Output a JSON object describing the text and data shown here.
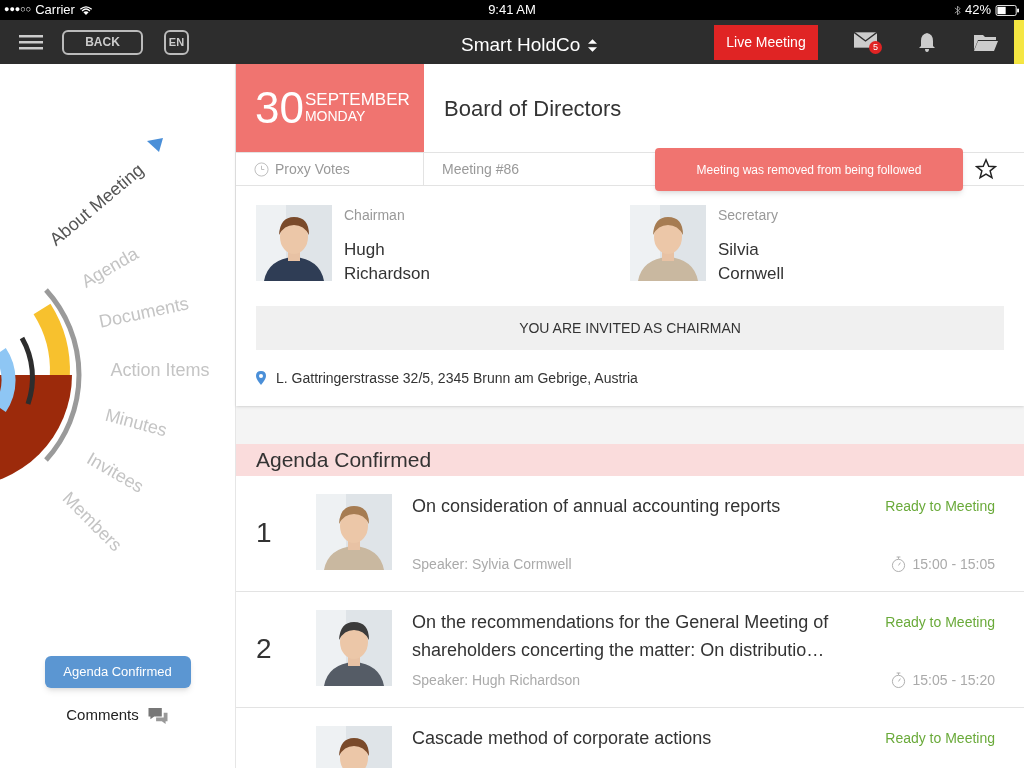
{
  "status_bar": {
    "signal": "●●●○○",
    "carrier": "Carrier",
    "time": "9:41 AM",
    "battery": "42%"
  },
  "nav": {
    "back": "BACK",
    "language": "EN",
    "title": "Smart HoldCo",
    "live": "Live Meeting",
    "mail_count": "5"
  },
  "sidebar": {
    "items": [
      {
        "label": "About Meeting",
        "selected": true
      },
      {
        "label": "Agenda",
        "selected": false
      },
      {
        "label": "Documents",
        "selected": false
      },
      {
        "label": "Action Items",
        "selected": false
      },
      {
        "label": "Minutes",
        "selected": false
      },
      {
        "label": "Invitees",
        "selected": false
      },
      {
        "label": "Members",
        "selected": false
      }
    ],
    "status_button": "Agenda Confirmed",
    "comments": "Comments"
  },
  "meeting": {
    "day": "30",
    "month": "SEPTEMBER",
    "weekday": "MONDAY",
    "title": "Board of Directors",
    "proxy": "Proxy Votes",
    "number": "Meeting #86",
    "followed": false,
    "toast": "Meeting was removed from being followed",
    "people": [
      {
        "role": "Chairman",
        "first": "Hugh",
        "last": "Richardson"
      },
      {
        "role": "Secretary",
        "first": "Silvia",
        "last": "Cornwell"
      }
    ],
    "invite": "YOU ARE INVITED AS CHAIRMAN",
    "address": "L. Gattringerstrasse 32/5, 2345 Brunn am Gebrige, Austria"
  },
  "agenda": {
    "title": "Agenda Confirmed",
    "rows": [
      {
        "number": "1",
        "title": "On consideration of annual accounting reports",
        "status": "Ready to Meeting",
        "speaker": "Speaker: Sylvia Cormwell",
        "time": "15:00 - 15:05"
      },
      {
        "number": "2",
        "title": "On the recommendations for the General Meeting of shareholders concerting the matter: On distributio…",
        "status": "Ready to Meeting",
        "speaker": "Speaker: Hugh Richardson",
        "time": "15:05 - 15:20"
      },
      {
        "title": "Cascade method of corporate actions",
        "status": "Ready to Meeting"
      }
    ]
  }
}
